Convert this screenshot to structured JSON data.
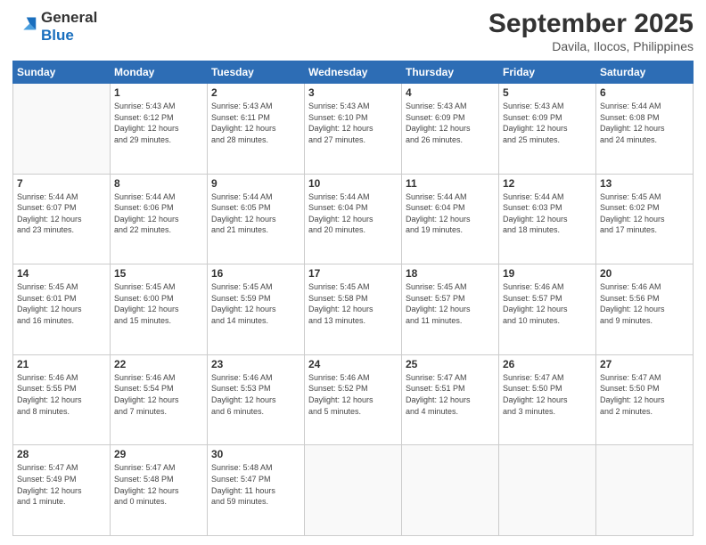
{
  "logo": {
    "line1": "General",
    "line2": "Blue"
  },
  "header": {
    "month": "September 2025",
    "location": "Davila, Ilocos, Philippines"
  },
  "weekdays": [
    "Sunday",
    "Monday",
    "Tuesday",
    "Wednesday",
    "Thursday",
    "Friday",
    "Saturday"
  ],
  "weeks": [
    [
      {
        "day": "",
        "info": ""
      },
      {
        "day": "1",
        "info": "Sunrise: 5:43 AM\nSunset: 6:12 PM\nDaylight: 12 hours\nand 29 minutes."
      },
      {
        "day": "2",
        "info": "Sunrise: 5:43 AM\nSunset: 6:11 PM\nDaylight: 12 hours\nand 28 minutes."
      },
      {
        "day": "3",
        "info": "Sunrise: 5:43 AM\nSunset: 6:10 PM\nDaylight: 12 hours\nand 27 minutes."
      },
      {
        "day": "4",
        "info": "Sunrise: 5:43 AM\nSunset: 6:09 PM\nDaylight: 12 hours\nand 26 minutes."
      },
      {
        "day": "5",
        "info": "Sunrise: 5:43 AM\nSunset: 6:09 PM\nDaylight: 12 hours\nand 25 minutes."
      },
      {
        "day": "6",
        "info": "Sunrise: 5:44 AM\nSunset: 6:08 PM\nDaylight: 12 hours\nand 24 minutes."
      }
    ],
    [
      {
        "day": "7",
        "info": "Sunrise: 5:44 AM\nSunset: 6:07 PM\nDaylight: 12 hours\nand 23 minutes."
      },
      {
        "day": "8",
        "info": "Sunrise: 5:44 AM\nSunset: 6:06 PM\nDaylight: 12 hours\nand 22 minutes."
      },
      {
        "day": "9",
        "info": "Sunrise: 5:44 AM\nSunset: 6:05 PM\nDaylight: 12 hours\nand 21 minutes."
      },
      {
        "day": "10",
        "info": "Sunrise: 5:44 AM\nSunset: 6:04 PM\nDaylight: 12 hours\nand 20 minutes."
      },
      {
        "day": "11",
        "info": "Sunrise: 5:44 AM\nSunset: 6:04 PM\nDaylight: 12 hours\nand 19 minutes."
      },
      {
        "day": "12",
        "info": "Sunrise: 5:44 AM\nSunset: 6:03 PM\nDaylight: 12 hours\nand 18 minutes."
      },
      {
        "day": "13",
        "info": "Sunrise: 5:45 AM\nSunset: 6:02 PM\nDaylight: 12 hours\nand 17 minutes."
      }
    ],
    [
      {
        "day": "14",
        "info": "Sunrise: 5:45 AM\nSunset: 6:01 PM\nDaylight: 12 hours\nand 16 minutes."
      },
      {
        "day": "15",
        "info": "Sunrise: 5:45 AM\nSunset: 6:00 PM\nDaylight: 12 hours\nand 15 minutes."
      },
      {
        "day": "16",
        "info": "Sunrise: 5:45 AM\nSunset: 5:59 PM\nDaylight: 12 hours\nand 14 minutes."
      },
      {
        "day": "17",
        "info": "Sunrise: 5:45 AM\nSunset: 5:58 PM\nDaylight: 12 hours\nand 13 minutes."
      },
      {
        "day": "18",
        "info": "Sunrise: 5:45 AM\nSunset: 5:57 PM\nDaylight: 12 hours\nand 11 minutes."
      },
      {
        "day": "19",
        "info": "Sunrise: 5:46 AM\nSunset: 5:57 PM\nDaylight: 12 hours\nand 10 minutes."
      },
      {
        "day": "20",
        "info": "Sunrise: 5:46 AM\nSunset: 5:56 PM\nDaylight: 12 hours\nand 9 minutes."
      }
    ],
    [
      {
        "day": "21",
        "info": "Sunrise: 5:46 AM\nSunset: 5:55 PM\nDaylight: 12 hours\nand 8 minutes."
      },
      {
        "day": "22",
        "info": "Sunrise: 5:46 AM\nSunset: 5:54 PM\nDaylight: 12 hours\nand 7 minutes."
      },
      {
        "day": "23",
        "info": "Sunrise: 5:46 AM\nSunset: 5:53 PM\nDaylight: 12 hours\nand 6 minutes."
      },
      {
        "day": "24",
        "info": "Sunrise: 5:46 AM\nSunset: 5:52 PM\nDaylight: 12 hours\nand 5 minutes."
      },
      {
        "day": "25",
        "info": "Sunrise: 5:47 AM\nSunset: 5:51 PM\nDaylight: 12 hours\nand 4 minutes."
      },
      {
        "day": "26",
        "info": "Sunrise: 5:47 AM\nSunset: 5:50 PM\nDaylight: 12 hours\nand 3 minutes."
      },
      {
        "day": "27",
        "info": "Sunrise: 5:47 AM\nSunset: 5:50 PM\nDaylight: 12 hours\nand 2 minutes."
      }
    ],
    [
      {
        "day": "28",
        "info": "Sunrise: 5:47 AM\nSunset: 5:49 PM\nDaylight: 12 hours\nand 1 minute."
      },
      {
        "day": "29",
        "info": "Sunrise: 5:47 AM\nSunset: 5:48 PM\nDaylight: 12 hours\nand 0 minutes."
      },
      {
        "day": "30",
        "info": "Sunrise: 5:48 AM\nSunset: 5:47 PM\nDaylight: 11 hours\nand 59 minutes."
      },
      {
        "day": "",
        "info": ""
      },
      {
        "day": "",
        "info": ""
      },
      {
        "day": "",
        "info": ""
      },
      {
        "day": "",
        "info": ""
      }
    ]
  ]
}
